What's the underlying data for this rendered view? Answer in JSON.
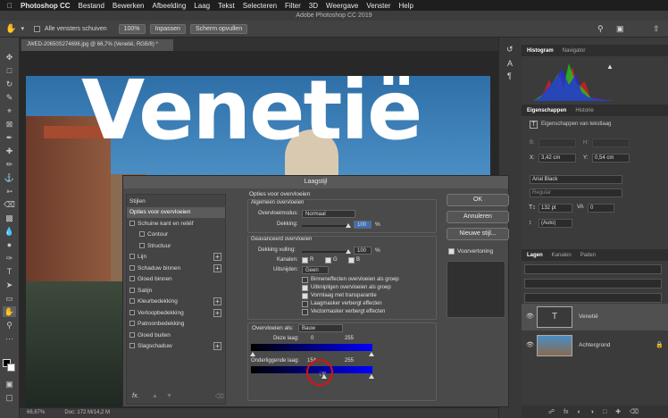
{
  "menubar": {
    "apple": "",
    "app": "Photoshop CC",
    "items": [
      "Bestand",
      "Bewerken",
      "Afbeelding",
      "Laag",
      "Tekst",
      "Selecteren",
      "Filter",
      "3D",
      "Weergave",
      "Venster",
      "Help"
    ]
  },
  "window_title": "Adobe Photoshop CC 2019",
  "options": {
    "scroll_all": "Alle vensters schuiven",
    "zoom": "100%",
    "fit_label": "Inpassen",
    "fill_label": "Scherm opvullen"
  },
  "doc_tab": "JWED-20650S274696.jpg @ 66,7% (Venetië, RGB/8) *",
  "canvas_text": "Venetië",
  "status": {
    "zoom": "66,67%",
    "doc": "Doc: 172 M/14,2 M"
  },
  "panels": {
    "histogram_tabs": [
      "Histogram",
      "Navigator"
    ],
    "properties_tabs": [
      "Eigenschappen",
      "Historie"
    ],
    "properties_title": "Eigenschappen van tekstlaag",
    "w_label": "B:",
    "h_label": "H:",
    "x_label": "X:",
    "x_val": "3,42 cm",
    "y_label": "Y:",
    "y_val": "0,54 cm",
    "font": "Arial Black",
    "style": "Regular",
    "size": "132 pt",
    "tracking": "0",
    "leading": "(Auto)",
    "layers_tabs": [
      "Lagen",
      "Kanalen",
      "Paden"
    ],
    "layers": [
      {
        "name": "Venetië",
        "thumb": "T"
      },
      {
        "name": "Achtergrond",
        "thumb": ""
      }
    ]
  },
  "dialog": {
    "title": "Laagstijl",
    "styles_header": "Stijlen",
    "styles": [
      {
        "label": "Opties voor overvloeien",
        "check": false,
        "plus": false,
        "hascheck": false,
        "selected": true
      },
      {
        "label": "Schuine kant en reliëf",
        "check": false,
        "plus": false,
        "hascheck": true
      },
      {
        "label": "Contour",
        "check": false,
        "plus": false,
        "hascheck": true,
        "indent": true
      },
      {
        "label": "Structuur",
        "check": false,
        "plus": false,
        "hascheck": true,
        "indent": true
      },
      {
        "label": "Lijn",
        "check": false,
        "plus": true,
        "hascheck": true
      },
      {
        "label": "Schaduw binnen",
        "check": false,
        "plus": true,
        "hascheck": true
      },
      {
        "label": "Gloed binnen",
        "check": false,
        "plus": false,
        "hascheck": true
      },
      {
        "label": "Satijn",
        "check": false,
        "plus": false,
        "hascheck": true
      },
      {
        "label": "Kleurbedekking",
        "check": false,
        "plus": true,
        "hascheck": true
      },
      {
        "label": "Verloopbedekking",
        "check": false,
        "plus": true,
        "hascheck": true
      },
      {
        "label": "Patroonbedekking",
        "check": false,
        "plus": false,
        "hascheck": true
      },
      {
        "label": "Gloed buiten",
        "check": false,
        "plus": false,
        "hascheck": true
      },
      {
        "label": "Slagschaduw",
        "check": false,
        "plus": true,
        "hascheck": true
      }
    ],
    "fx": "fx.",
    "main_title": "Opties voor overvloeien",
    "general_title": "Algemeen overvloeien",
    "blend_mode_label": "Overvloeimodus:",
    "blend_mode": "Normaal",
    "opacity_label": "Dekking:",
    "opacity": "100",
    "pct": "%",
    "opacity_level": 1.0,
    "advanced_title": "Geavanceerd overvloeien",
    "fill_label": "Dekking vulling:",
    "fill": "100",
    "fill_level": 1.0,
    "channels_label": "Kanalen:",
    "ch_r": "R",
    "ch_g": "G",
    "ch_b": "B",
    "knockout_label": "Uitsnijden:",
    "knockout": "Geen",
    "adv_options": [
      {
        "label": "Binneneffecten overvloeien als groep",
        "checked": false
      },
      {
        "label": "Uitknipligen overvloeien als groep",
        "checked": true
      },
      {
        "label": "Vormlaag met transparantie",
        "checked": true
      },
      {
        "label": "Laagmasker verbergt effecten",
        "checked": false
      },
      {
        "label": "Vectormasker verbergt effecten",
        "checked": false
      }
    ],
    "blendif_label": "Overvloeien als:",
    "blendif": "Bauw",
    "this_layer_label": "Deze laag:",
    "this_low": "0",
    "this_high": "255",
    "under_label": "Onderliggende laag:",
    "under_low": "154",
    "under_high": "255",
    "under_knob_level": 0.6,
    "ok": "OK",
    "cancel": "Annuleren",
    "new_style": "Nieuwe stijl...",
    "preview_label": "Voorvertoning"
  }
}
